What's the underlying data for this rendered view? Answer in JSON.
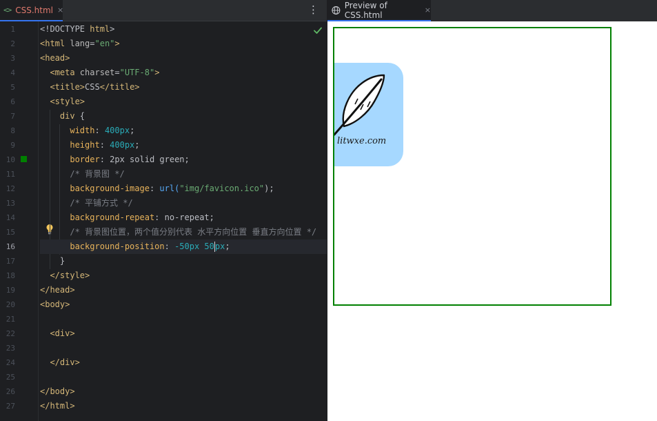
{
  "editor": {
    "tab": {
      "icon": "html-file-icon",
      "icon_glyph": "<>",
      "label": "CSS.html",
      "close": "×"
    },
    "menu_glyph": "⋮",
    "inspection_status": "check-icon",
    "current_line": 16,
    "line_numbers": [
      "1",
      "2",
      "3",
      "4",
      "5",
      "6",
      "7",
      "8",
      "9",
      "10",
      "11",
      "12",
      "13",
      "14",
      "15",
      "16",
      "17",
      "18",
      "19",
      "20",
      "21",
      "22",
      "23",
      "24",
      "25",
      "26",
      "27"
    ],
    "lines": [
      [
        {
          "t": "<!DOCTYPE ",
          "c": "plain"
        },
        {
          "t": "html",
          "c": "tag"
        },
        {
          "t": ">",
          "c": "plain"
        }
      ],
      [
        {
          "t": "<html ",
          "c": "tag"
        },
        {
          "t": "lang",
          "c": "attr"
        },
        {
          "t": "=",
          "c": "plain"
        },
        {
          "t": "\"en\"",
          "c": "val"
        },
        {
          "t": ">",
          "c": "tag"
        }
      ],
      [
        {
          "t": "<head>",
          "c": "tag"
        }
      ],
      [
        {
          "t": "  <meta ",
          "c": "tag"
        },
        {
          "t": "charset",
          "c": "attr"
        },
        {
          "t": "=",
          "c": "plain"
        },
        {
          "t": "\"UTF-8\"",
          "c": "val"
        },
        {
          "t": ">",
          "c": "tag"
        }
      ],
      [
        {
          "t": "  <title>",
          "c": "tag"
        },
        {
          "t": "CSS",
          "c": "plain"
        },
        {
          "t": "</title>",
          "c": "tag"
        }
      ],
      [
        {
          "t": "  <style>",
          "c": "tag"
        }
      ],
      [
        {
          "t": "    div ",
          "c": "sel"
        },
        {
          "t": "{",
          "c": "plain"
        }
      ],
      [
        {
          "t": "      width",
          "c": "prop"
        },
        {
          "t": ": ",
          "c": "plain"
        },
        {
          "t": "400px",
          "c": "num"
        },
        {
          "t": ";",
          "c": "plain"
        }
      ],
      [
        {
          "t": "      height",
          "c": "prop"
        },
        {
          "t": ": ",
          "c": "plain"
        },
        {
          "t": "400px",
          "c": "num"
        },
        {
          "t": ";",
          "c": "plain"
        }
      ],
      [
        {
          "t": "      border",
          "c": "prop"
        },
        {
          "t": ": ",
          "c": "plain"
        },
        {
          "t": "2px solid green",
          "c": "plain"
        },
        {
          "t": ";",
          "c": "plain"
        }
      ],
      [
        {
          "t": "      /* 背景图 */",
          "c": "cmt"
        }
      ],
      [
        {
          "t": "      background-image",
          "c": "prop"
        },
        {
          "t": ": ",
          "c": "plain"
        },
        {
          "t": "url(",
          "c": "fn"
        },
        {
          "t": "\"img/favicon.ico\"",
          "c": "val"
        },
        {
          "t": ");",
          "c": "plain"
        }
      ],
      [
        {
          "t": "      /* 平铺方式 */",
          "c": "cmt"
        }
      ],
      [
        {
          "t": "      background-repeat",
          "c": "prop"
        },
        {
          "t": ": ",
          "c": "plain"
        },
        {
          "t": "no-repeat",
          "c": "plain"
        },
        {
          "t": ";",
          "c": "plain"
        }
      ],
      [
        {
          "t": "      /* 背景图位置，两个值分别代表 水平方向位置 垂直方向位置 */",
          "c": "cmt"
        }
      ],
      [
        {
          "t": "      background-position",
          "c": "prop"
        },
        {
          "t": ": ",
          "c": "plain"
        },
        {
          "t": "-50px 50",
          "c": "num"
        },
        {
          "t": "|",
          "c": "caret"
        },
        {
          "t": "px",
          "c": "num"
        },
        {
          "t": ";",
          "c": "plain"
        }
      ],
      [
        {
          "t": "    }",
          "c": "plain"
        }
      ],
      [
        {
          "t": "  </style>",
          "c": "tag"
        }
      ],
      [
        {
          "t": "</head>",
          "c": "tag"
        }
      ],
      [
        {
          "t": "<body>",
          "c": "tag"
        }
      ],
      [],
      [
        {
          "t": "  <div>",
          "c": "tag"
        }
      ],
      [],
      [
        {
          "t": "  </div>",
          "c": "tag"
        }
      ],
      [],
      [
        {
          "t": "</body>",
          "c": "tag"
        }
      ],
      [
        {
          "t": "</html>",
          "c": "tag"
        }
      ]
    ],
    "gutter_color_swatch": "#008000"
  },
  "preview": {
    "tab": {
      "icon": "globe-icon",
      "label": "Preview of CSS.html",
      "close": "×"
    },
    "box_border_color": "#008000",
    "favicon": {
      "background": "#a6d8ff",
      "icon": "feather-icon",
      "text": "litwxe.com"
    }
  }
}
